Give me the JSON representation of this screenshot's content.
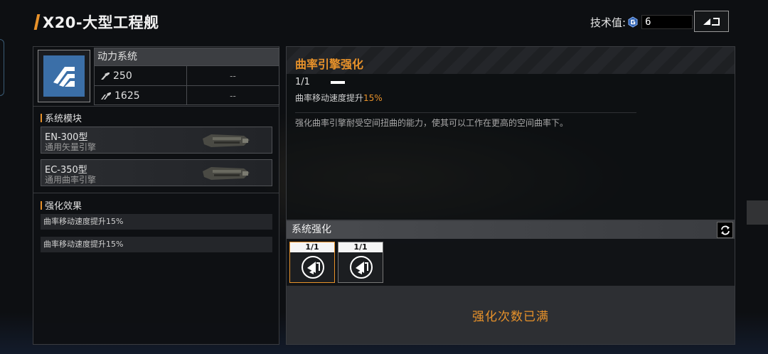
{
  "header": {
    "title": "X20-大型工程舰",
    "tech_label": "技术值:",
    "tech_value": "6"
  },
  "module": {
    "system_name": "动力系统",
    "stats": [
      {
        "icon": "speed-icon",
        "value": "250",
        "extra": "--"
      },
      {
        "icon": "accel-icon",
        "value": "1625",
        "extra": "--"
      }
    ]
  },
  "system_modules": {
    "label": "系统模块",
    "engines": [
      {
        "name": "EN-300型",
        "type": "通用矢量引擎"
      },
      {
        "name": "EC-350型",
        "type": "通用曲率引擎"
      }
    ]
  },
  "enhance_effects": {
    "label": "强化效果",
    "items": [
      "曲率移动速度提升15%",
      "曲率移动速度提升15%"
    ]
  },
  "detail": {
    "title": "曲率引擎强化",
    "level": "1/1",
    "effect_prefix": "曲率移动速度提升",
    "effect_value": "15%",
    "description": "强化曲率引擎耐受空间扭曲的能力，使其可以工作在更高的空间曲率下。"
  },
  "system_enhance": {
    "label": "系统强化",
    "slots": [
      {
        "level": "1/1",
        "selected": true
      },
      {
        "level": "1/1",
        "selected": false
      }
    ],
    "max_text": "强化次数已满"
  },
  "colors": {
    "accent": "#e8922a",
    "module_icon_bg": "#3b6fa8"
  }
}
